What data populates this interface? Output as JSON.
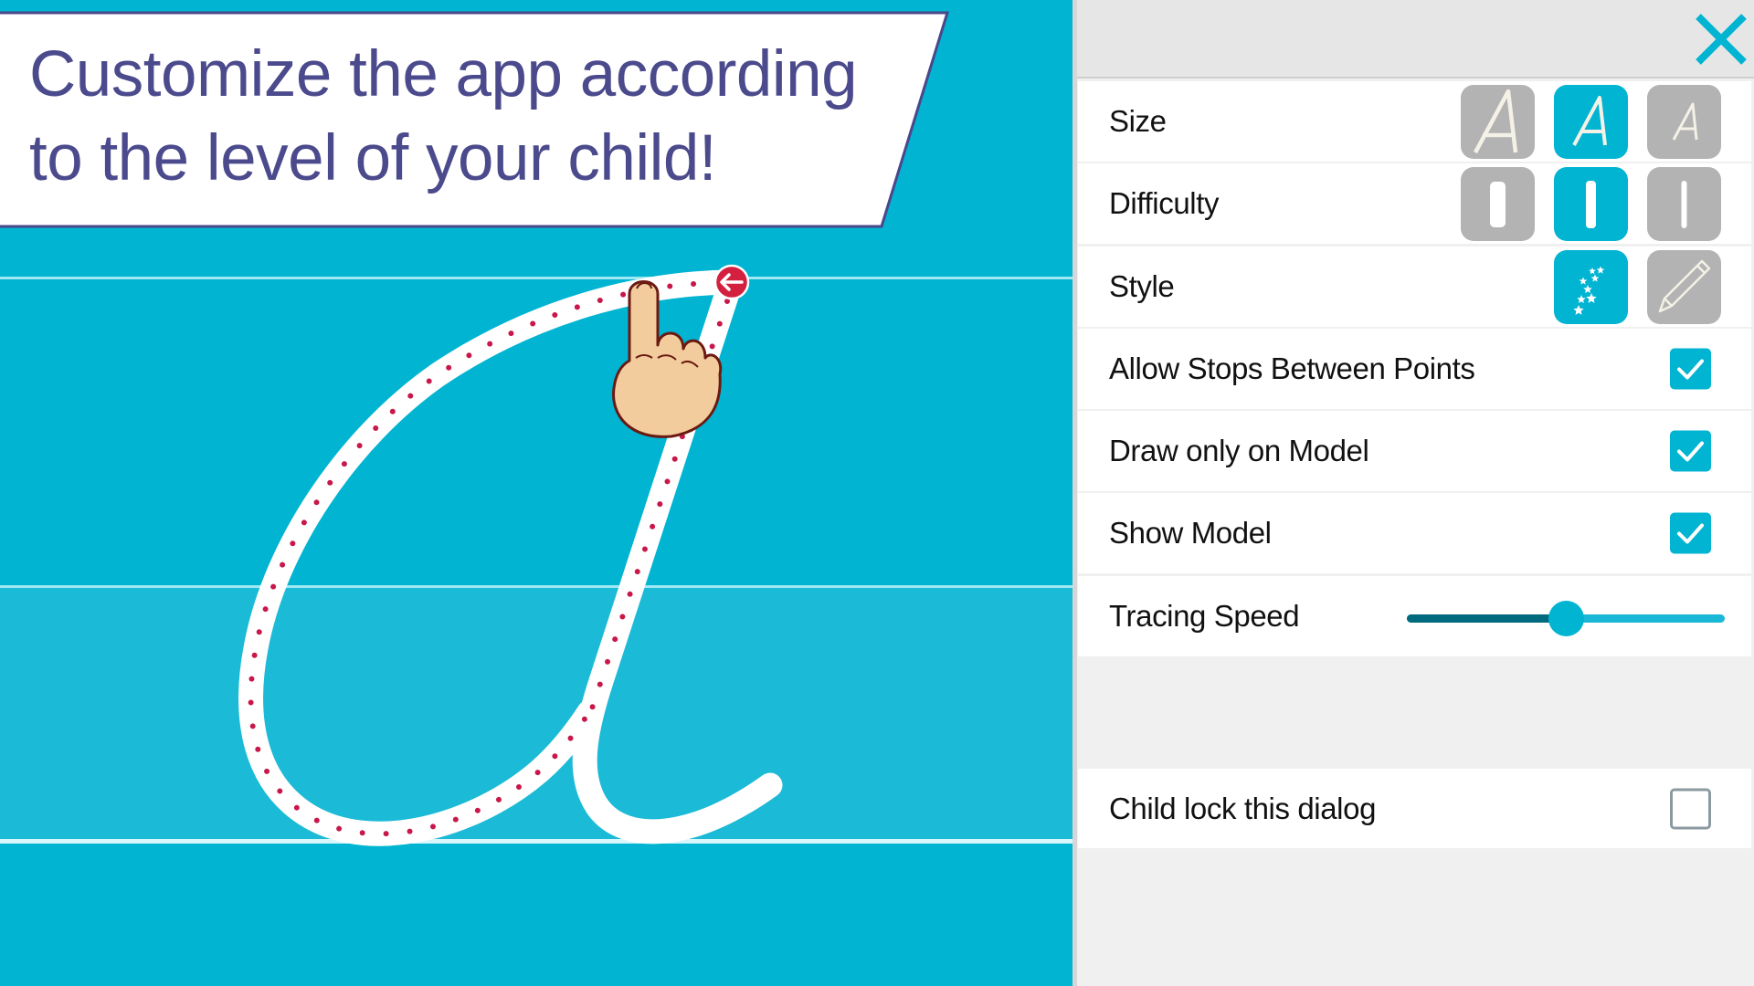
{
  "banner": {
    "line1": "Customize the app according",
    "line2": "to the level of your child!"
  },
  "colors": {
    "accent": "#00b4d2",
    "canvas_background": "#00b4d2",
    "canvas_lower_band": "#1bbad6",
    "banner_text": "#4b4a8c",
    "banner_border": "#4a478a",
    "tracing_dots": "#c8174a",
    "start_marker": "#d3203f",
    "button_inactive": "#b3b3b3",
    "slider_fill": "#006b7f",
    "slider_track": "#1ab8d6"
  },
  "canvas": {
    "letter": "a",
    "style": "cursive",
    "start_marker_icon": "arrow-left-icon",
    "hand_icon": "pointing-hand-icon"
  },
  "panel": {
    "close_icon": "close-icon",
    "settings": [
      {
        "id": "size",
        "label": "Size",
        "type": "options",
        "options": [
          {
            "name": "large",
            "icon": "letter-a-large-icon",
            "glyph": "A",
            "selected": false
          },
          {
            "name": "medium",
            "icon": "letter-a-medium-icon",
            "glyph": "A",
            "selected": true
          },
          {
            "name": "small",
            "icon": "letter-a-small-icon",
            "glyph": "A",
            "selected": false
          }
        ]
      },
      {
        "id": "difficulty",
        "label": "Difficulty",
        "type": "options",
        "options": [
          {
            "name": "easy",
            "icon": "wide-bar-icon",
            "selected": false
          },
          {
            "name": "medium",
            "icon": "medium-bar-icon",
            "selected": true
          },
          {
            "name": "hard",
            "icon": "thin-bar-icon",
            "selected": false
          }
        ]
      },
      {
        "id": "style",
        "label": "Style",
        "type": "options",
        "options": [
          {
            "name": "stars",
            "icon": "stars-icon",
            "selected": true
          },
          {
            "name": "pencil",
            "icon": "pencil-icon",
            "selected": false
          }
        ]
      },
      {
        "id": "allow_stops",
        "label": "Allow Stops Between Points",
        "type": "checkbox",
        "checked": true
      },
      {
        "id": "draw_only_on_model",
        "label": "Draw only on Model",
        "type": "checkbox",
        "checked": true
      },
      {
        "id": "show_model",
        "label": "Show Model",
        "type": "checkbox",
        "checked": true
      },
      {
        "id": "tracing_speed",
        "label": "Tracing Speed",
        "type": "slider",
        "value": 0.5
      }
    ],
    "child_lock": {
      "label": "Child lock this dialog",
      "checked": false
    }
  }
}
